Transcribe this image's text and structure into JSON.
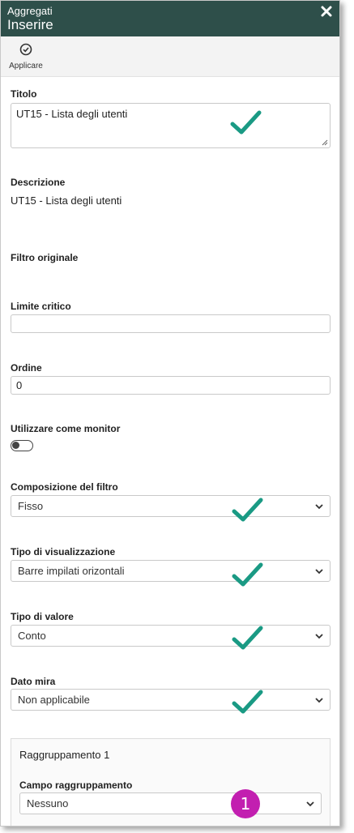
{
  "window": {
    "supertitle": "Aggregati",
    "title": "Inserire"
  },
  "toolbar": {
    "apply_label": "Applicare"
  },
  "form": {
    "titolo": {
      "label": "Titolo",
      "value": "UT15 - Lista degli utenti"
    },
    "descrizione": {
      "label": "Descrizione",
      "value": "UT15 - Lista degli utenti"
    },
    "filtro_originale": {
      "label": "Filtro originale"
    },
    "limite_critico": {
      "label": "Limite critico",
      "value": ""
    },
    "ordine": {
      "label": "Ordine",
      "value": "0"
    },
    "monitor": {
      "label": "Utilizzare come monitor",
      "enabled": false
    },
    "composizione": {
      "label": "Composizione del filtro",
      "value": "Fisso"
    },
    "tipo_visualizzazione": {
      "label": "Tipo di visualizzazione",
      "value": "Barre impilati orizontali"
    },
    "tipo_valore": {
      "label": "Tipo di valore",
      "value": "Conto"
    },
    "dato_mira": {
      "label": "Dato mira",
      "value": "Non applicabile"
    }
  },
  "grouping": {
    "title": "Raggruppamento 1",
    "field_label": "Campo raggruppamento",
    "field_value": "Nessuno"
  },
  "annotation": {
    "badge_number": "1",
    "check_color": "#1a9a84",
    "badge_color": "#c21fb0"
  },
  "colors": {
    "header_bg": "#2e4f4a"
  }
}
